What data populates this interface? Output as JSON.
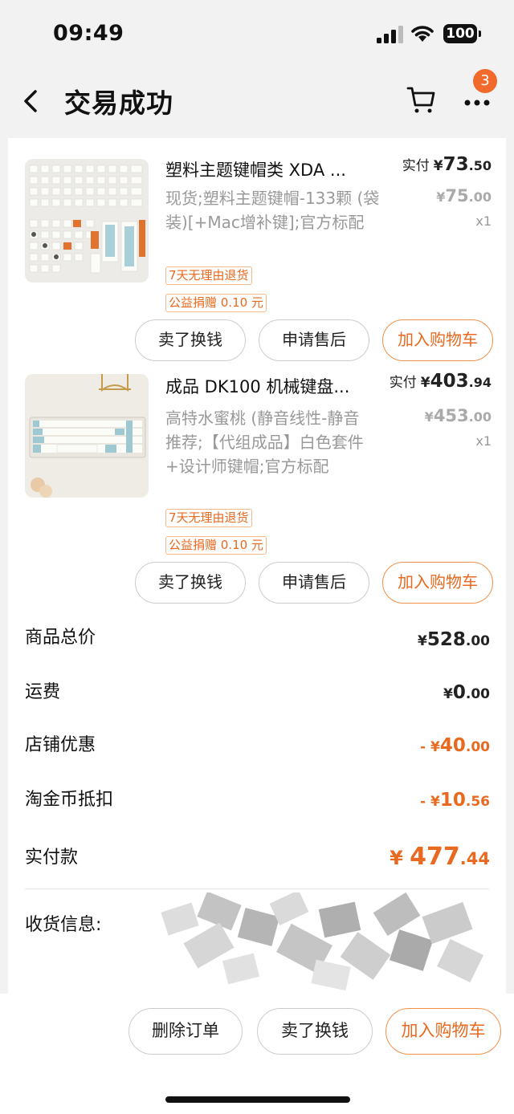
{
  "status_bar": {
    "time": "09:49",
    "battery": "100"
  },
  "nav": {
    "title": "交易成功",
    "badge_count": "3"
  },
  "products": [
    {
      "title": "塑料主题键帽类 XDA ...",
      "spec": "现货;塑料主题键帽-133颗 (袋装)[+Mac增补键];官方标配",
      "tags": [
        "7天无理由退货",
        "公益捐赠 0.10 元"
      ],
      "paid_label": "实付",
      "paid_symbol": "¥",
      "paid_int": "73",
      "paid_dec": ".50",
      "orig_symbol": "¥",
      "orig_int": "75",
      "orig_dec": ".00",
      "qty": "x1",
      "buttons": [
        "卖了换钱",
        "申请售后",
        "加入购物车"
      ]
    },
    {
      "title": "成品 DK100 机械键盘...",
      "spec": "高特水蜜桃 (静音线性-静音推荐;【代组成品】白色套件+设计师键帽;官方标配",
      "tags": [
        "7天无理由退货",
        "公益捐赠 0.10 元"
      ],
      "paid_label": "实付",
      "paid_symbol": "¥",
      "paid_int": "403",
      "paid_dec": ".94",
      "orig_symbol": "¥",
      "orig_int": "453",
      "orig_dec": ".00",
      "qty": "x1",
      "buttons": [
        "卖了换钱",
        "申请售后",
        "加入购物车"
      ]
    }
  ],
  "summary": [
    {
      "label": "商品总价",
      "prefix": "",
      "symbol": "¥",
      "int": "528",
      "dec": ".00"
    },
    {
      "label": "运费",
      "prefix": "",
      "symbol": "¥",
      "int": "0",
      "dec": ".00"
    },
    {
      "label": "店铺优惠",
      "prefix": "- ",
      "symbol": "¥",
      "int": "40",
      "dec": ".00"
    },
    {
      "label": "淘金币抵扣",
      "prefix": "- ",
      "symbol": "¥",
      "int": "10",
      "dec": ".56"
    },
    {
      "label": "实付款",
      "prefix": "",
      "symbol": "¥ ",
      "int": "477",
      "dec": ".44"
    }
  ],
  "address": {
    "label": "收货信息:"
  },
  "bottom_bar": {
    "delete": "删除订单",
    "resell": "卖了换钱",
    "add_cart": "加入购物车"
  },
  "colors": {
    "accent": "#e8691f",
    "badge": "#f26a2b",
    "background": "#f2f2f2"
  }
}
